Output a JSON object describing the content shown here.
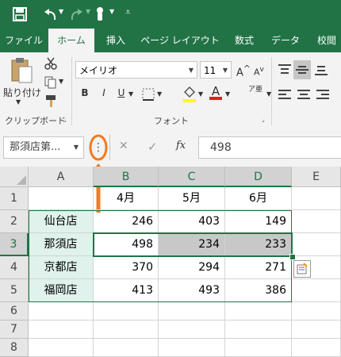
{
  "tabs": [
    "ファイル",
    "ホーム",
    "挿入",
    "ページ レイアウト",
    "数式",
    "データ",
    "校閲"
  ],
  "ribbon": {
    "paste_label": "貼り付け",
    "font_name": "メイリオ",
    "font_size": "11",
    "bold": "B",
    "italic": "I",
    "underline": "U",
    "group_clipboard": "クリップボード",
    "group_font": "フォント",
    "font_color_letter": "A",
    "phonetic_label": "ア亜"
  },
  "formula_bar": {
    "name_box": "那須店第...",
    "cancel": "✕",
    "enter": "✓",
    "fx": "fx",
    "value": "498",
    "options_dots": "⋮"
  },
  "columns": [
    "A",
    "B",
    "C",
    "D",
    "E"
  ],
  "rows": [
    "1",
    "2",
    "3",
    "4",
    "5",
    "6",
    "7",
    "8"
  ],
  "table": {
    "headers": [
      "4月",
      "5月",
      "6月"
    ],
    "rows": [
      {
        "store": "仙台店",
        "v1": "246",
        "v2": "403",
        "v3": "149"
      },
      {
        "store": "那須店",
        "v1": "498",
        "v2": "234",
        "v3": "233"
      },
      {
        "store": "京都店",
        "v1": "370",
        "v2": "294",
        "v3": "271"
      },
      {
        "store": "福岡店",
        "v1": "413",
        "v2": "493",
        "v3": "386"
      }
    ]
  },
  "colors": {
    "excel_green": "#217346",
    "annotation_orange": "#f07a22",
    "selection_gray": "#c8c8c8",
    "store_fill": "#dff2ec"
  },
  "icons": [
    "save-icon",
    "undo-icon",
    "redo-icon",
    "touch-mode-icon",
    "customize-qat-icon",
    "paste-icon",
    "cut-icon",
    "copy-icon",
    "format-painter-icon",
    "fill-color-icon",
    "font-color-icon",
    "quick-analysis-icon"
  ]
}
